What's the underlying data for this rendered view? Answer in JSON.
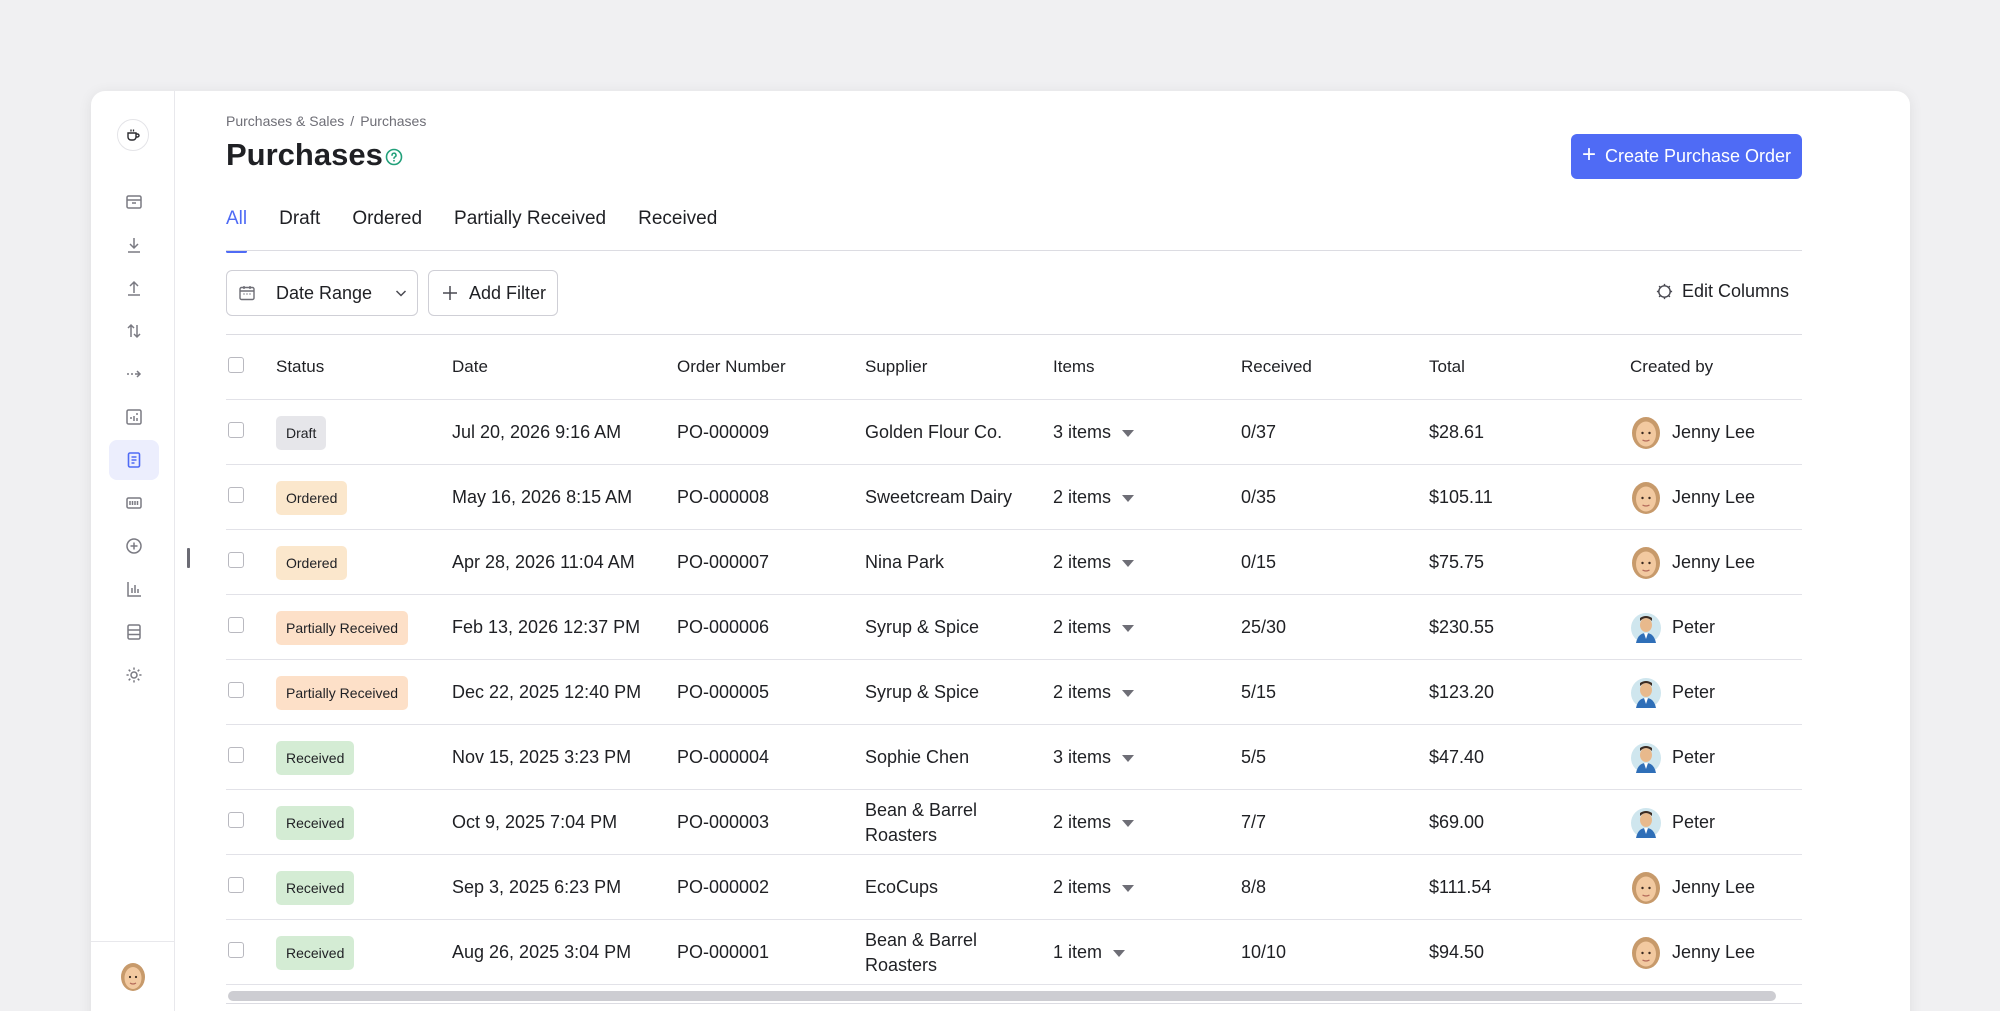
{
  "breadcrumb": {
    "parent": "Purchases & Sales",
    "separator": "/",
    "current": "Purchases"
  },
  "page": {
    "title": "Purchases"
  },
  "actions": {
    "create_label": "Create Purchase Order"
  },
  "tabs": [
    {
      "label": "All",
      "active": true
    },
    {
      "label": "Draft",
      "active": false
    },
    {
      "label": "Ordered",
      "active": false
    },
    {
      "label": "Partially Received",
      "active": false
    },
    {
      "label": "Received",
      "active": false
    }
  ],
  "filters": {
    "date_range_label": "Date Range",
    "add_filter_label": "Add Filter",
    "edit_columns_label": "Edit Columns"
  },
  "table": {
    "columns": [
      "Status",
      "Date",
      "Order Number",
      "Supplier",
      "Items",
      "Received",
      "Total",
      "Created by"
    ],
    "rows": [
      {
        "status": "Draft",
        "date": "Jul 20, 2026 9:16 AM",
        "order": "PO-000009",
        "supplier": "Golden Flour Co.",
        "items": "3 items",
        "received": "0/37",
        "total": "$28.61",
        "created_by": "Jenny Lee"
      },
      {
        "status": "Ordered",
        "date": "May 16, 2026 8:15 AM",
        "order": "PO-000008",
        "supplier": "Sweetcream Dairy",
        "items": "2 items",
        "received": "0/35",
        "total": "$105.11",
        "created_by": "Jenny Lee"
      },
      {
        "status": "Ordered",
        "date": "Apr 28, 2026 11:04 AM",
        "order": "PO-000007",
        "supplier": "Nina Park",
        "items": "2 items",
        "received": "0/15",
        "total": "$75.75",
        "created_by": "Jenny Lee"
      },
      {
        "status": "Partially Received",
        "date": "Feb 13, 2026 12:37 PM",
        "order": "PO-000006",
        "supplier": "Syrup & Spice",
        "items": "2 items",
        "received": "25/30",
        "total": "$230.55",
        "created_by": "Peter"
      },
      {
        "status": "Partially Received",
        "date": "Dec 22, 2025 12:40 PM",
        "order": "PO-000005",
        "supplier": "Syrup & Spice",
        "items": "2 items",
        "received": "5/15",
        "total": "$123.20",
        "created_by": "Peter"
      },
      {
        "status": "Received",
        "date": "Nov 15, 2025 3:23 PM",
        "order": "PO-000004",
        "supplier": "Sophie Chen",
        "items": "3 items",
        "received": "5/5",
        "total": "$47.40",
        "created_by": "Peter"
      },
      {
        "status": "Received",
        "date": "Oct 9, 2025 7:04 PM",
        "order": "PO-000003",
        "supplier": "Bean & Barrel Roasters",
        "items": "2 items",
        "received": "7/7",
        "total": "$69.00",
        "created_by": "Peter"
      },
      {
        "status": "Received",
        "date": "Sep 3, 2025 6:23 PM",
        "order": "PO-000002",
        "supplier": "EcoCups",
        "items": "2 items",
        "received": "8/8",
        "total": "$111.54",
        "created_by": "Jenny Lee"
      },
      {
        "status": "Received",
        "date": "Aug 26, 2025 3:04 PM",
        "order": "PO-000001",
        "supplier": "Bean & Barrel Roasters",
        "items": "1 item",
        "received": "10/10",
        "total": "$94.50",
        "created_by": "Jenny Lee"
      }
    ]
  },
  "colors": {
    "accent": "#4f6bf5",
    "status_draft": "#e6e6ea",
    "status_ordered": "#fbe7cc",
    "status_partial": "#fde0c8",
    "status_received": "#d4ecd4"
  },
  "sidebar": {
    "icons": [
      "box-icon",
      "download-icon",
      "upload-icon",
      "transfer-icon",
      "move-icon",
      "adjustments-icon",
      "purchases-icon",
      "barcode-icon",
      "add-circle-icon",
      "chart-icon",
      "database-icon",
      "settings-icon"
    ],
    "active": "purchases-icon"
  }
}
